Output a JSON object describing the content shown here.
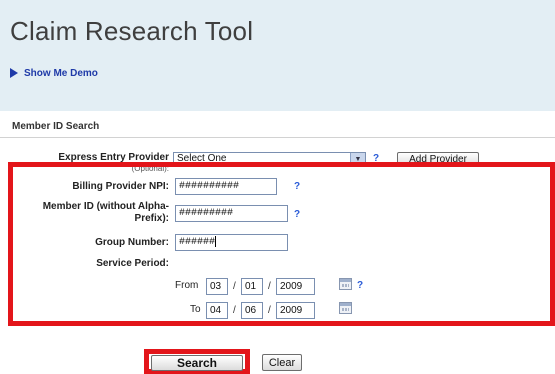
{
  "header": {
    "title": "Claim Research Tool",
    "demo_link": "Show Me Demo"
  },
  "section": {
    "title": "Member ID Search"
  },
  "form": {
    "express_entry": {
      "label": "Express Entry Provider",
      "sublabel": "(Optional):",
      "select_value": "Select One",
      "help": "?",
      "add_provider_label": "Add Provider"
    },
    "billing_npi": {
      "label": "Billing Provider NPI:",
      "value": "##########",
      "help": "?"
    },
    "member_id": {
      "label_line1": "Member ID (without Alpha-",
      "label_line2": "Prefix):",
      "value": "#########",
      "help": "?"
    },
    "group_number": {
      "label": "Group Number:",
      "value": "######"
    },
    "service_period": {
      "label": "Service Period:",
      "from_label": "From",
      "from_month": "03",
      "from_day": "01",
      "from_year": "2009",
      "to_label": "To",
      "to_month": "04",
      "to_day": "06",
      "to_year": "2009",
      "separator": "/",
      "help": "?"
    }
  },
  "actions": {
    "search_label": "Search",
    "clear_label": "Clear"
  },
  "colors": {
    "banner": "#e3eef4",
    "link": "#1f3aa8",
    "help": "#2a5bd7",
    "highlight": "#e3151a"
  }
}
